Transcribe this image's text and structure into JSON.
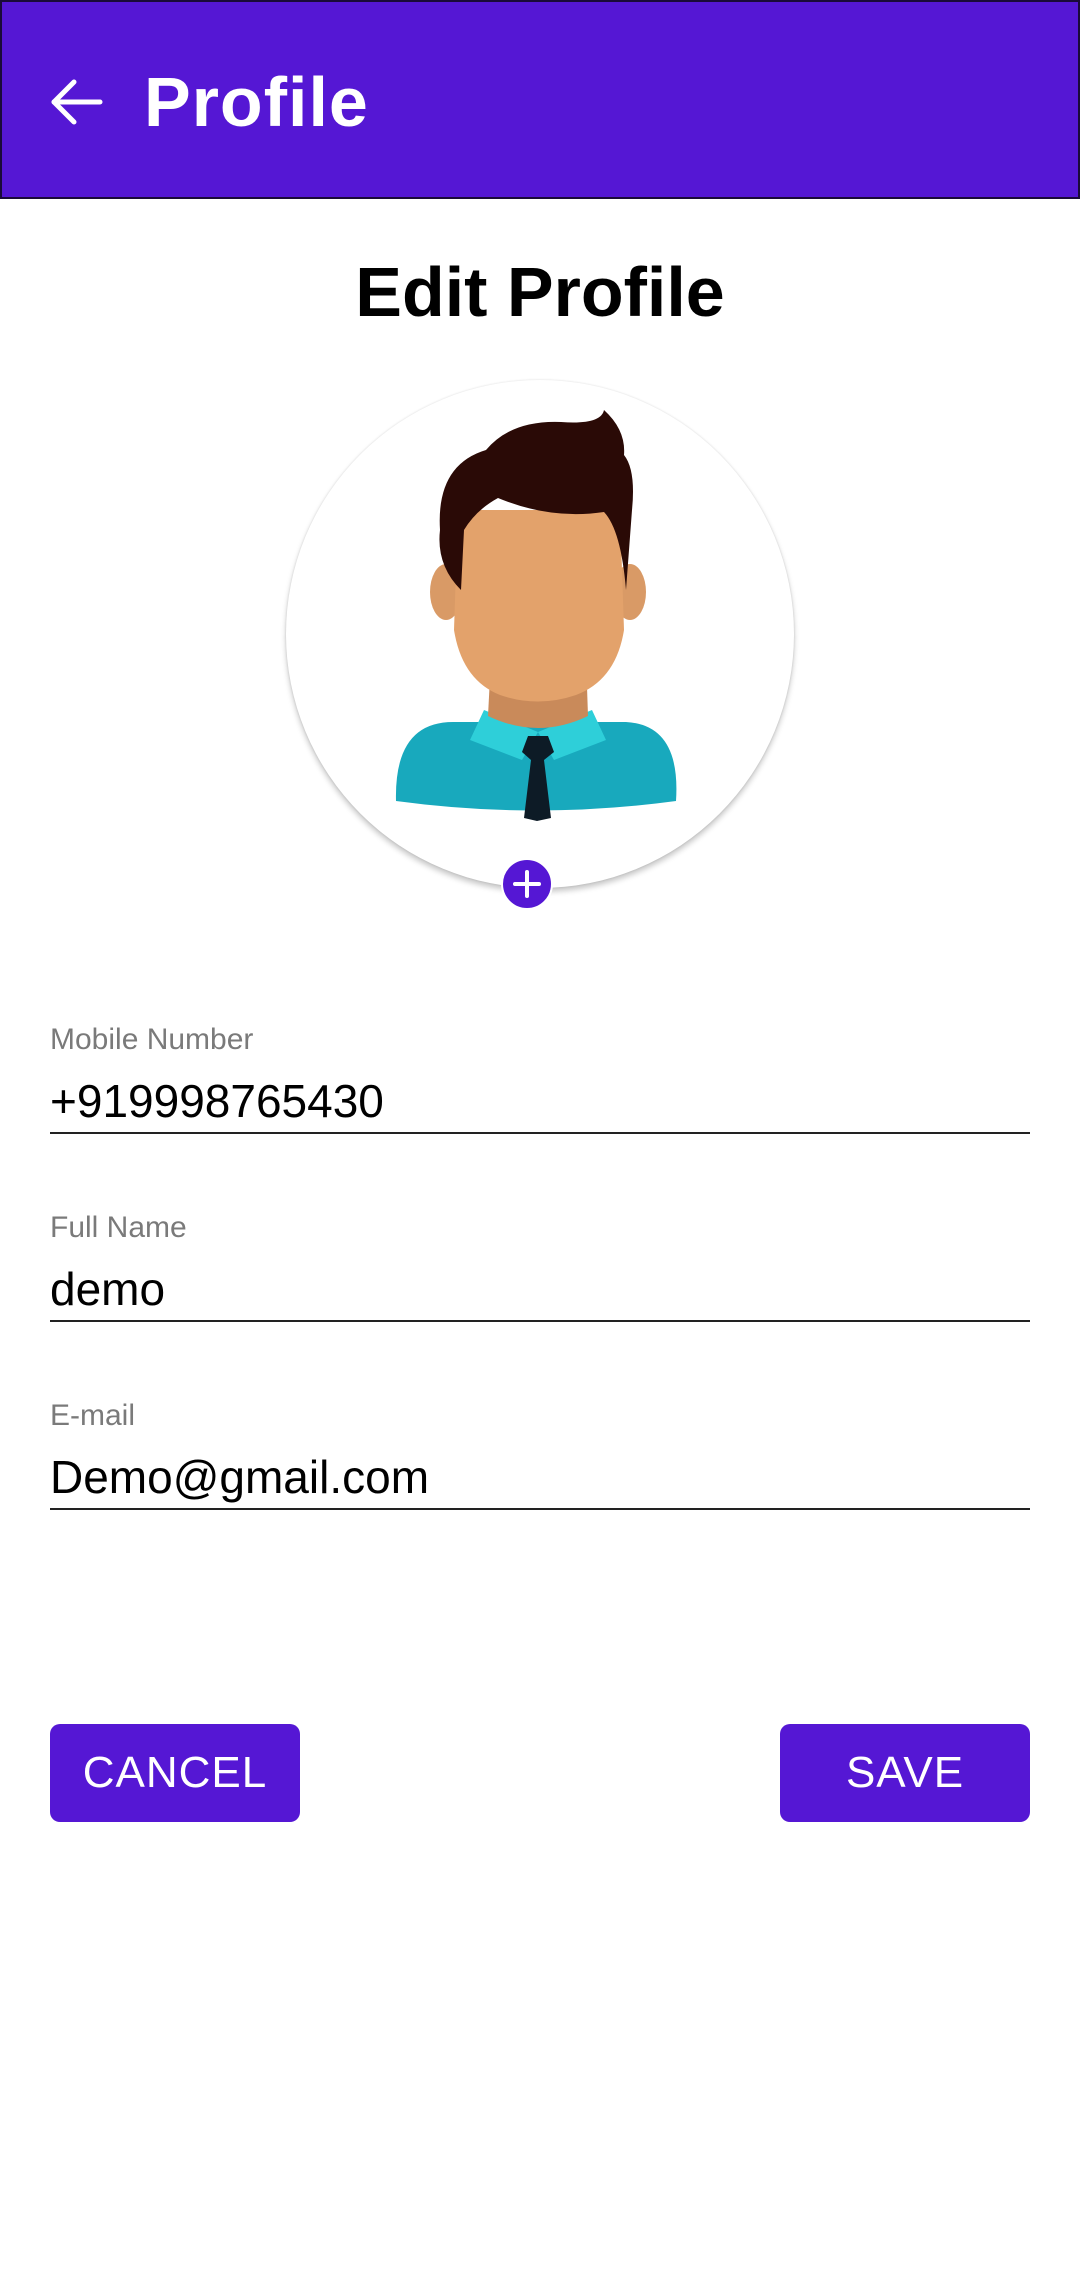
{
  "app_bar": {
    "title": "Profile",
    "back_icon": "arrow-left-icon",
    "background": "#5517d4"
  },
  "page": {
    "title": "Edit Profile"
  },
  "avatar": {
    "icon": "person-avatar-icon",
    "add_icon": "plus-icon"
  },
  "form": {
    "mobile": {
      "label": "Mobile Number",
      "value": "+919998765430"
    },
    "name": {
      "label": "Full Name",
      "value": "demo"
    },
    "email": {
      "label": "E-mail",
      "value": "Demo@gmail.com"
    }
  },
  "actions": {
    "cancel_label": "CANCEL",
    "save_label": "SAVE",
    "accent": "#5517d4"
  }
}
